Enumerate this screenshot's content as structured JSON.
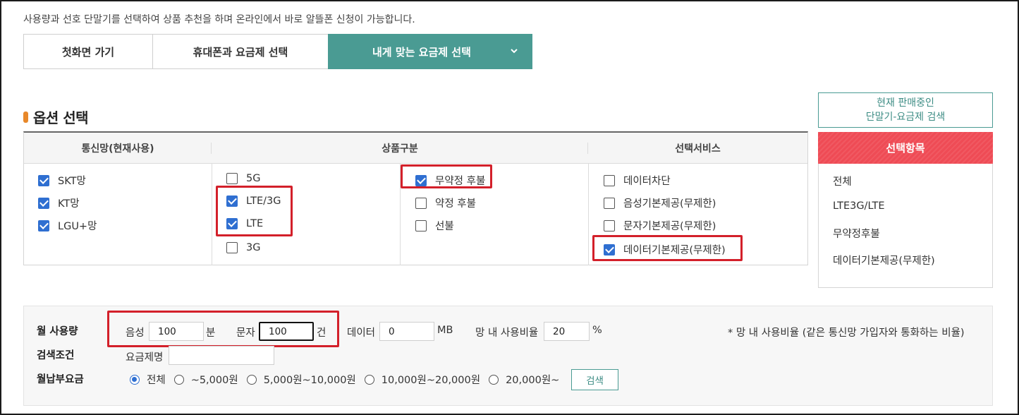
{
  "intro": "사용량과 선호 단말기를 선택하여 상품 추천을 하며 온라인에서 바로 알뜰폰 신청이 가능합니다.",
  "nav": {
    "home": "첫화면 가기",
    "phone_plan": "휴대폰과 요금제 선택",
    "my_plan": "내게 맞는 요금제 선택"
  },
  "options": {
    "title": "옵션 선택",
    "headers": {
      "network": "통신망(현재사용)",
      "product": "상품구분",
      "service": "선택서비스"
    },
    "network": [
      {
        "label": "SKT망",
        "checked": true
      },
      {
        "label": "KT망",
        "checked": true
      },
      {
        "label": "LGU+망",
        "checked": true
      }
    ],
    "product_type": [
      {
        "label": "5G",
        "checked": false
      },
      {
        "label": "LTE/3G",
        "checked": true
      },
      {
        "label": "LTE",
        "checked": true
      },
      {
        "label": "3G",
        "checked": false
      }
    ],
    "contract": [
      {
        "label": "무약정 후불",
        "checked": true
      },
      {
        "label": "약정 후불",
        "checked": false
      },
      {
        "label": "선불",
        "checked": false
      }
    ],
    "services": [
      {
        "label": "데이터차단",
        "checked": false
      },
      {
        "label": "음성기본제공(무제한)",
        "checked": false
      },
      {
        "label": "문자기본제공(무제한)",
        "checked": false
      },
      {
        "label": "데이터기본제공(무제한)",
        "checked": true
      }
    ]
  },
  "side": {
    "search_now_line1": "현재 판매중인",
    "search_now_line2": "단말기-요금제 검색",
    "selected_header": "선택항목",
    "selected_items": [
      "전체",
      "LTE3G/LTE",
      "무약정후불",
      "데이터기본제공(무제한)"
    ]
  },
  "usage": {
    "label_monthly": "월 사용량",
    "label_criteria": "검색조건",
    "label_fee": "월납부요금",
    "voice_label": "음성",
    "voice_value": "100",
    "voice_unit": "분",
    "sms_label": "문자",
    "sms_value": "100",
    "sms_unit": "건",
    "data_label": "데이터",
    "data_value": "0",
    "data_unit": "MB",
    "ratio_label": "망 내 사용비율",
    "ratio_value": "20",
    "ratio_unit": "%",
    "ratio_note": "* 망 내 사용비율 (같은 통신망 가입자와 통화하는 비율)",
    "plan_name_label": "요금제명",
    "plan_name_value": "",
    "fee_options": [
      {
        "label": "전체",
        "selected": true
      },
      {
        "label": "~5,000원",
        "selected": false
      },
      {
        "label": "5,000원~10,000원",
        "selected": false
      },
      {
        "label": "10,000원~20,000원",
        "selected": false
      },
      {
        "label": "20,000원~",
        "selected": false
      }
    ],
    "search_button": "검색"
  },
  "colors": {
    "teal": "#4a9b93",
    "red_header": "#ef4b55",
    "highlight_red": "#d3202a",
    "checkbox_blue": "#2f6fd1"
  }
}
